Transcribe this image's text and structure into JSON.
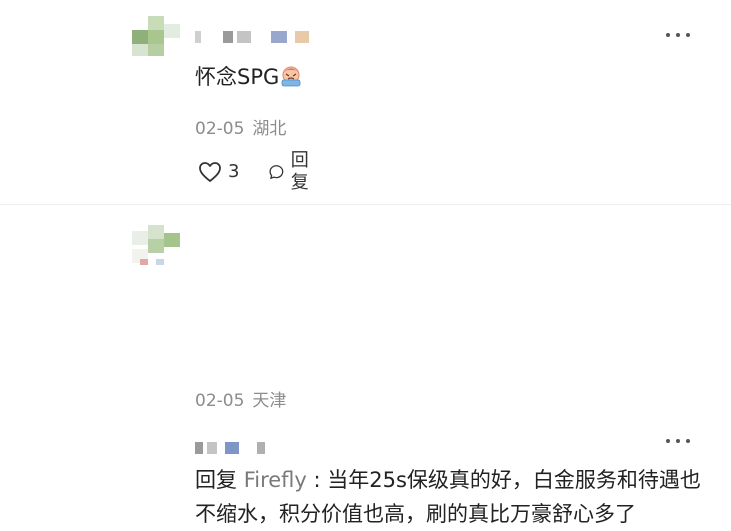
{
  "comments": [
    {
      "content": "怀念SPG",
      "emoji": "teary-face-emoji",
      "date": "02-05",
      "location": "湖北",
      "like_count": "3",
      "reply_label": "回复"
    },
    {
      "reply_prefix": "回复",
      "mention": "Firefly",
      "separator": " : ",
      "content": "当年25s保级真的好，白金服务和待遇也不缩水，积分价值也高，刷的真比万豪舒心多了",
      "date": "02-05",
      "location": "天津"
    }
  ],
  "icons": {
    "more": "more-dots-icon",
    "like": "heart-icon",
    "reply": "chat-bubble-icon"
  },
  "colors": {
    "text": "#222222",
    "meta": "#8c8c8c",
    "mention": "#7a7a7a"
  }
}
